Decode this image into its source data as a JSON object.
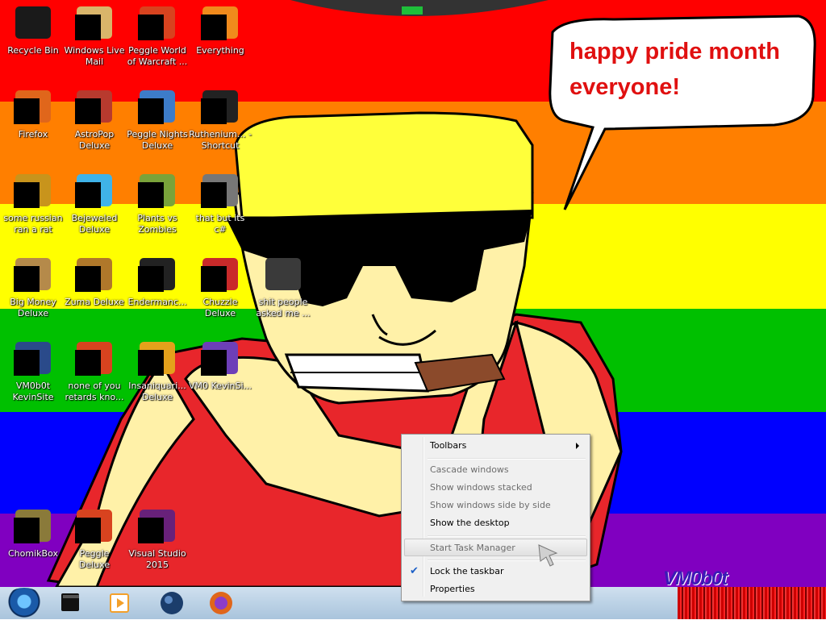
{
  "desktop": {
    "icons": [
      {
        "label": "Recycle Bin",
        "icon": "recycle-bin-icon",
        "color": "#1a1a1a"
      },
      {
        "label": "Windows Live Mail",
        "icon": "mail-icon",
        "color": "#d9b56a"
      },
      {
        "label": "Peggle World of Warcraft ...",
        "icon": "peggle-icon",
        "color": "#d8431f"
      },
      {
        "label": "Everything",
        "icon": "search-icon",
        "color": "#f08a1c"
      },
      {
        "label": "Firefox",
        "icon": "firefox-icon",
        "color": "#e0661b"
      },
      {
        "label": "AstroPop Deluxe",
        "icon": "game-icon",
        "color": "#b83a2e"
      },
      {
        "label": "Peggle Nights Deluxe",
        "icon": "peggle-icon",
        "color": "#3d7cc9"
      },
      {
        "label": "Ruthenium... - Shortcut",
        "icon": "terminal-icon",
        "color": "#222222"
      },
      {
        "label": "some russian ran a rat",
        "icon": "file-icon",
        "color": "#c8941c"
      },
      {
        "label": "Bejeweled Deluxe",
        "icon": "gem-icon",
        "color": "#3fb3e8"
      },
      {
        "label": "Plants vs Zombies",
        "icon": "plant-icon",
        "color": "#7aa33a"
      },
      {
        "label": "that but its c#",
        "icon": "folder-icon",
        "color": "#777777"
      },
      {
        "label": "Big Money Deluxe",
        "icon": "money-bag-icon",
        "color": "#b58a4a"
      },
      {
        "label": "Zuma Deluxe",
        "icon": "frog-icon",
        "color": "#b0782a"
      },
      {
        "label": "Endermanc...",
        "icon": "terminal-icon",
        "color": "#222222"
      },
      {
        "label": "Chuzzle Deluxe",
        "icon": "game-icon",
        "color": "#c92a2a"
      },
      {
        "label": "VM0b0t KevinSite",
        "icon": "code-icon",
        "color": "#2a4a8a"
      },
      {
        "label": "none of you retards kno...",
        "icon": "game-icon",
        "color": "#d8431f"
      },
      {
        "label": "Insaniquari... Deluxe",
        "icon": "fish-icon",
        "color": "#e4a11b"
      },
      {
        "label": "VM0 KevinSi...",
        "icon": "code-icon",
        "color": "#6d3fb8"
      },
      {
        "label": "ChomikBox",
        "icon": "hamster-icon",
        "color": "#8a7a3a"
      },
      {
        "label": "Peggle Deluxe",
        "icon": "peggle-icon",
        "color": "#d8431f"
      },
      {
        "label": "Visual Studio 2015",
        "icon": "visual-studio-icon",
        "color": "#68217a"
      },
      {
        "label": "shit people asked me ...",
        "icon": "folder-icon",
        "color": "#3a3a3a"
      }
    ],
    "speech_bubble": {
      "line1": "happy pride month",
      "line2": "everyone!"
    },
    "watermark": "VM0b0t"
  },
  "taskbar": {
    "start": "start-orb-icon",
    "pinned": [
      {
        "name": "taskbar-app-1",
        "icon": "window-icon",
        "color": "#111111"
      },
      {
        "name": "taskbar-media-player",
        "icon": "media-player-icon",
        "color": "#f3a02a"
      },
      {
        "name": "taskbar-app-3",
        "icon": "globe-icon",
        "color": "#1b3d6b"
      },
      {
        "name": "taskbar-firefox",
        "icon": "firefox-icon",
        "color": "#e0661b"
      }
    ]
  },
  "context_menu": {
    "toolbars": "Toolbars",
    "cascade": "Cascade windows",
    "stacked": "Show windows stacked",
    "side_by_side": "Show windows side by side",
    "show_desktop": "Show the desktop",
    "task_manager": "Start Task Manager",
    "lock_taskbar": "Lock the taskbar",
    "properties": "Properties",
    "check_mark": "✔"
  },
  "colors": {
    "pride": [
      "#ff0000",
      "#ff7f00",
      "#ffff00",
      "#00c000",
      "#0000ff",
      "#8000c0"
    ]
  }
}
